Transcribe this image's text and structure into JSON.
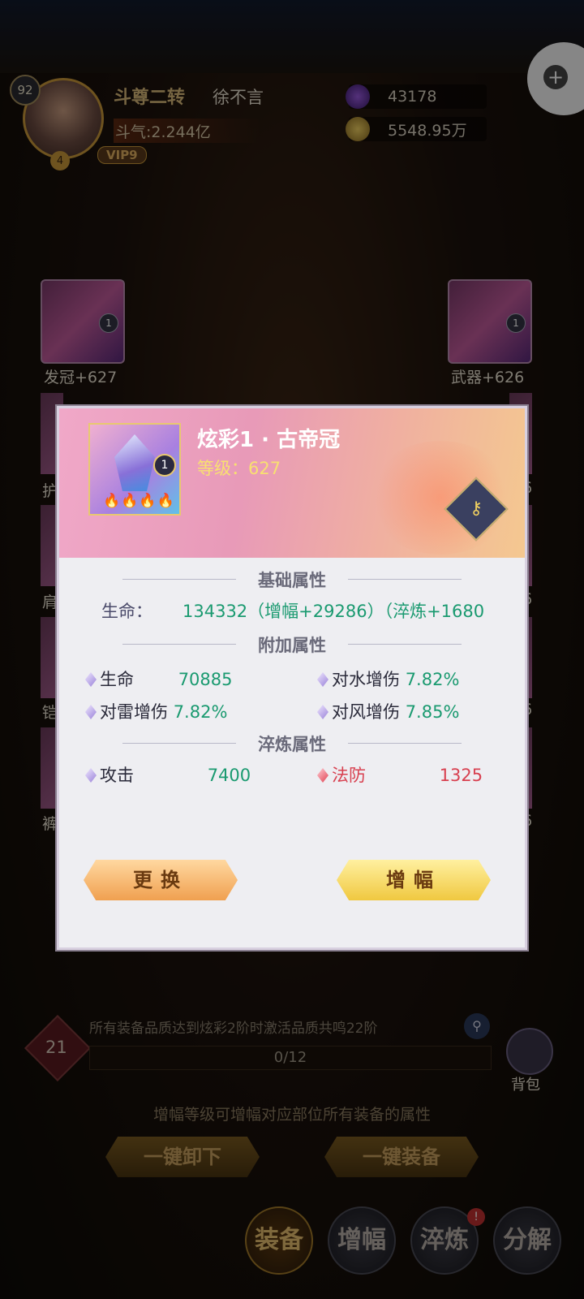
{
  "header": {
    "level": "92",
    "rank": "斗尊二转",
    "name": "徐不言",
    "douqi": "斗气:2.244亿",
    "vip": "VIP9",
    "stars": "4",
    "currency1": "43178",
    "currency2": "5548.95万"
  },
  "slots": {
    "left_top": {
      "label": "发冠+627",
      "level": "1"
    },
    "right_top": {
      "label": "武器+626",
      "level": "1"
    },
    "left_partial": [
      "护",
      "肩",
      "铠",
      "裤"
    ],
    "right_partial": [
      "26",
      "26",
      "26",
      "26"
    ]
  },
  "dialog": {
    "item_name": "炫彩1 · 古帝冠",
    "item_level": "等级：627",
    "item_badge": "1",
    "base_title": "基础属性",
    "base_label": "生命：",
    "base_value": "134332（增幅+29286）（淬炼+1680",
    "extra_title": "附加属性",
    "extra_attrs": [
      {
        "label": "生命",
        "value": "70885"
      },
      {
        "label": "对水增伤",
        "value": "7.82%"
      },
      {
        "label": "对雷增伤",
        "value": "7.82%"
      },
      {
        "label": "对风增伤",
        "value": "7.85%"
      }
    ],
    "refine_title": "淬炼属性",
    "refine_attrs": [
      {
        "label": "攻击",
        "value": "7400"
      },
      {
        "label": "法防",
        "value": "1325"
      }
    ],
    "btn_replace": "更换",
    "btn_amplify": "增幅"
  },
  "bottom": {
    "resonance_text": "所有装备品质达到炫彩2阶时激活品质共鸣22阶",
    "resonance_level": "21",
    "progress": "0/12",
    "bag_label": "背包",
    "hint": "增幅等级可增幅对应部位所有装备的属性",
    "btn_unequip_all": "一键卸下",
    "btn_equip_all": "一键装备",
    "tabs": [
      "装备",
      "增幅",
      "淬炼",
      "分解"
    ],
    "tab_badge": "!"
  },
  "colors": {
    "accent_green": "#1a9a70",
    "accent_red": "#d84050",
    "gold": "#f8e070"
  }
}
